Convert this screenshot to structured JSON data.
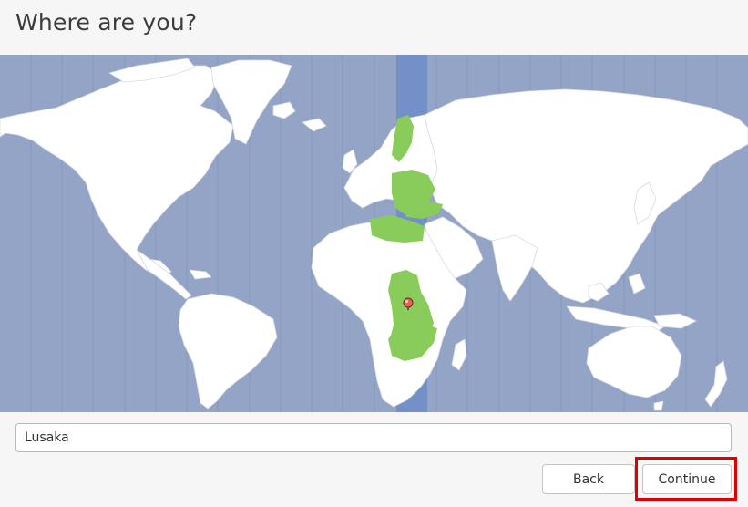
{
  "header": {
    "title": "Where are you?"
  },
  "map": {
    "selected_city": "Lusaka",
    "land_color": "#ffffff",
    "ocean_color": "#93a4c6",
    "timezone_band_color": "#7390c9",
    "selected_region_color": "#8acc5c",
    "pin_color": "#e0645a",
    "pin_icon": "map-pin-icon"
  },
  "location": {
    "value": "Lusaka"
  },
  "footer": {
    "back_label": "Back",
    "continue_label": "Continue",
    "highlight_color": "#e00000"
  }
}
